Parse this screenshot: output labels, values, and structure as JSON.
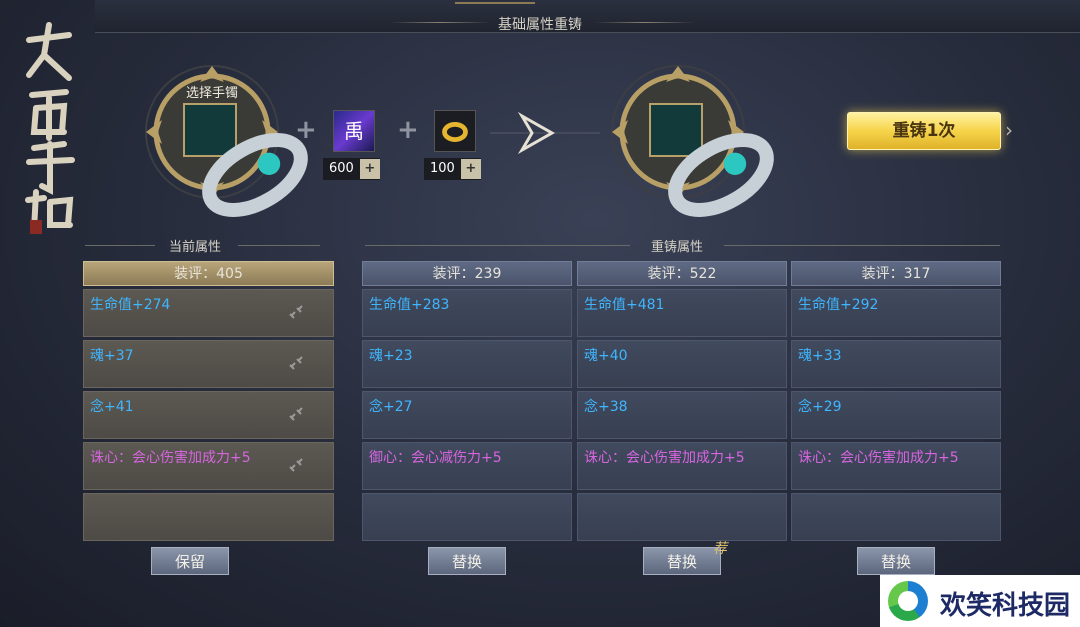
{
  "window": {
    "title": "基础属性重铸"
  },
  "brand": {
    "title_text": "大禹手镯"
  },
  "input_slot": {
    "label": "选择手镯",
    "item_icon": "bracelet-icon"
  },
  "materials": [
    {
      "icon": "rune-scroll-icon",
      "icon_text": "禹",
      "count": "600",
      "add_label": "+"
    },
    {
      "icon": "gold-ring-icon",
      "count": "100",
      "add_label": "+"
    }
  ],
  "output_slot": {
    "item_icon": "bracelet-icon"
  },
  "recast_button": {
    "label": "重铸1次"
  },
  "current": {
    "section_title": "当前属性",
    "score": "装评：405",
    "attributes": [
      {
        "text": "生命值+274",
        "color": "blue"
      },
      {
        "text": "魂+37",
        "color": "blue"
      },
      {
        "text": "念+41",
        "color": "blue"
      },
      {
        "text": "诛心：会心伤害加成力+5",
        "color": "pink"
      },
      {
        "text": "",
        "color": "blue"
      }
    ],
    "button": "保留"
  },
  "recast": {
    "section_title": "重铸属性",
    "columns": [
      {
        "score": "装评：239",
        "attributes": [
          {
            "text": "生命值+283",
            "color": "blue"
          },
          {
            "text": "魂+23",
            "color": "blue"
          },
          {
            "text": "念+27",
            "color": "blue"
          },
          {
            "text": "御心：会心减伤力+5",
            "color": "pink"
          },
          {
            "text": "",
            "color": "blue"
          }
        ],
        "button": "替换"
      },
      {
        "score": "装评：522",
        "attributes": [
          {
            "text": "生命值+481",
            "color": "blue"
          },
          {
            "text": "魂+40",
            "color": "blue"
          },
          {
            "text": "念+38",
            "color": "blue"
          },
          {
            "text": "诛心：会心伤害加成力+5",
            "color": "pink"
          },
          {
            "text": "",
            "color": "blue"
          }
        ],
        "button": "替换",
        "badge": "荐"
      },
      {
        "score": "装评：317",
        "attributes": [
          {
            "text": "生命值+292",
            "color": "blue"
          },
          {
            "text": "魂+33",
            "color": "blue"
          },
          {
            "text": "念+29",
            "color": "blue"
          },
          {
            "text": "诛心：会心伤害加成力+5",
            "color": "pink"
          },
          {
            "text": "",
            "color": "blue"
          }
        ],
        "button": "替换"
      }
    ]
  },
  "watermark": {
    "text": "欢笑科技园"
  },
  "colors": {
    "attr_blue": "#3fb6ff",
    "attr_pink": "#d765e0",
    "gold_button": "#f6d44a"
  }
}
